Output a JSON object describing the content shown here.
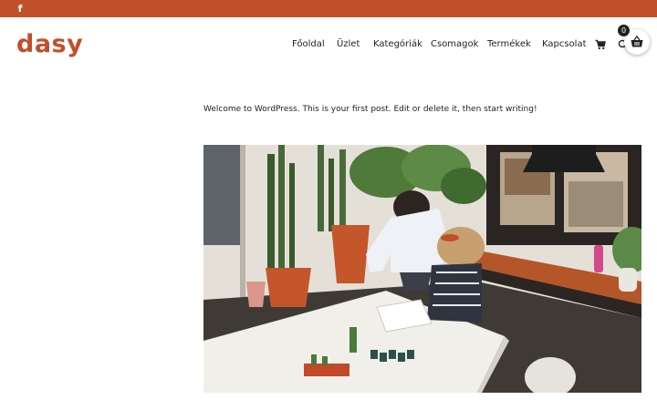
{
  "topbar": {
    "social_icon": "facebook-icon",
    "social_glyph": "f"
  },
  "brand": {
    "logo": "dasy",
    "color": "#c0502a"
  },
  "nav": {
    "items": [
      {
        "label": "Főoldal"
      },
      {
        "label": "Üzlet"
      },
      {
        "label": "Kategóriák"
      },
      {
        "label": "Csomagok"
      },
      {
        "label": "Termékek"
      },
      {
        "label": "Kapcsolat"
      }
    ],
    "cart_icon": "cart-icon",
    "search_icon": "search-icon"
  },
  "mini_cart": {
    "count": "0",
    "icon": "basket-icon"
  },
  "post": {
    "text": "Welcome to WordPress. This is your first post. Edit or delete it, then start writing!",
    "image": "photo-two-women-working-at-desk-with-plants"
  }
}
